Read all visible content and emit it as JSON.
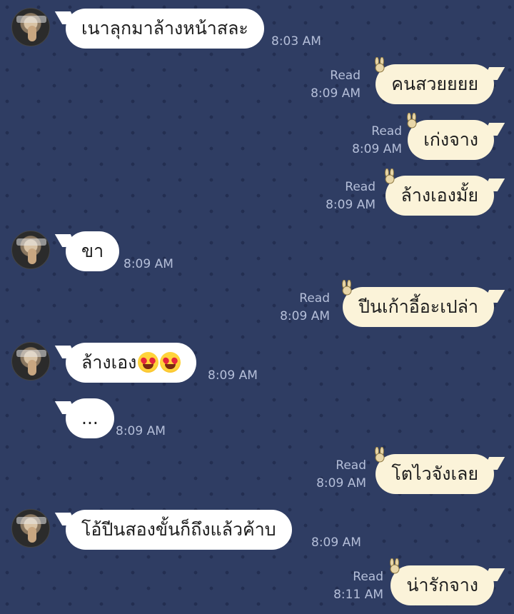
{
  "chat": {
    "messages": [
      {
        "dir": "in",
        "text": "เนาลุกมาล้างหน้าสละ",
        "time": "8:03 AM",
        "show_avatar": true
      },
      {
        "dir": "out",
        "text": "คนสวยยยย",
        "status": "Read",
        "time": "8:09 AM"
      },
      {
        "dir": "out",
        "text": "เก่งจาง",
        "status": "Read",
        "time": "8:09 AM"
      },
      {
        "dir": "out",
        "text": "ล้างเองมั้ย",
        "status": "Read",
        "time": "8:09 AM"
      },
      {
        "dir": "in",
        "text": "ขา",
        "time": "8:09 AM",
        "show_avatar": true
      },
      {
        "dir": "out",
        "text": "ปีนเก้าอี้อะเปล่า",
        "status": "Read",
        "time": "8:09 AM"
      },
      {
        "dir": "in",
        "text": "ล้างเอง",
        "emoji": "heart-eyes-emoji",
        "emoji_count": 2,
        "time": "8:09 AM",
        "show_avatar": true
      },
      {
        "dir": "in",
        "text": "...",
        "time": "8:09 AM",
        "show_avatar": false
      },
      {
        "dir": "out",
        "text": "โตไวจังเลย",
        "status": "Read",
        "time": "8:09 AM"
      },
      {
        "dir": "in",
        "text": "โอ้ปีนสองขั้นก็ถึงแล้วค้าบ",
        "time": "8:09 AM",
        "show_avatar": true
      },
      {
        "dir": "out",
        "text": "น่ารักจาง",
        "status": "Read",
        "time": "8:11 AM"
      }
    ]
  },
  "colors": {
    "background": "#2f3d63",
    "incoming_bubble": "#ffffff",
    "outgoing_bubble": "#fbf3d9",
    "meta_text": "#b5bfd9"
  },
  "icons": {
    "outgoing_sticker": "bunny-icon",
    "avatar": "avatar"
  }
}
